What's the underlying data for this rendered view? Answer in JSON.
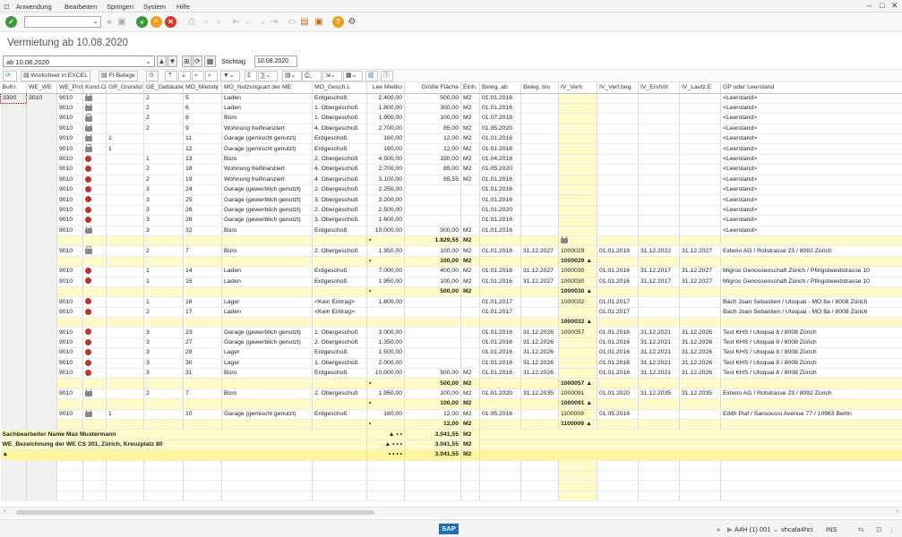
{
  "menu": {
    "items": [
      "Anwendung",
      "Bearbeiten",
      "Springen",
      "System",
      "Hilfe"
    ]
  },
  "toolbar": {
    "command_value": ""
  },
  "title": "Vermietung ab 10.08.2020",
  "selection": {
    "variant": "ab 10.08.2020",
    "stichtag_label": "Stichtag",
    "stichtag_value": "10.08.2020"
  },
  "grid_toolbar": {
    "worksheet_label": "Worksheet in EXCEL",
    "fi_label": "FI-Belege"
  },
  "table": {
    "headers": [
      "BuKr.",
      "WE_WE",
      "WE_Prctr",
      "Kond.Obj.I",
      "GR_Grundst",
      "GE_Gebäude",
      "MO_Mietobj",
      "MO_Nutzungsart der ME",
      "MO_Gesch.L",
      "Lee Mietko",
      "Größe Fläche",
      "Einh.",
      "Beleg. ab",
      "Beleg. bis",
      "IV_Vertr.",
      "IV_Vert.beg.",
      "IV_ErstVrt",
      "IV_Laufz.E",
      "GP oder Leerstand"
    ],
    "rows": [
      {
        "t": "d",
        "c": [
          "3300",
          "3010",
          "9010",
          "lock",
          "",
          "2",
          "5",
          "Laden",
          "Erdgeschoß",
          "2.400,00",
          "500,00",
          "M2",
          "01.01.2016",
          "",
          "",
          "",
          "",
          "",
          "<Leerstand>"
        ]
      },
      {
        "t": "d",
        "c": [
          "",
          "",
          "9010",
          "lock",
          "",
          "2",
          "6",
          "Laden",
          "1. Obergeschoß",
          "1.800,00",
          "300,00",
          "M2",
          "01.01.2016",
          "",
          "",
          "",
          "",
          "",
          "<Leerstand>"
        ]
      },
      {
        "t": "d",
        "c": [
          "",
          "",
          "9010",
          "lock",
          "",
          "2",
          "8",
          "Büro",
          "1. Obergeschoß",
          "1.950,00",
          "100,00",
          "M2",
          "01.07.2018",
          "",
          "",
          "",
          "",
          "",
          "<Leerstand>"
        ]
      },
      {
        "t": "d",
        "c": [
          "",
          "",
          "9010",
          "lock",
          "",
          "2",
          "9",
          "Wohnung freifinanziert",
          "4. Obergeschoß",
          "2.700,00",
          "85,00",
          "M2",
          "01.05.2020",
          "",
          "",
          "",
          "",
          "",
          "<Leerstand>"
        ]
      },
      {
        "t": "d",
        "c": [
          "",
          "",
          "9010",
          "lock",
          "1",
          "",
          "11",
          "Garage (gemischt genutzt)",
          "Erdgeschoß",
          "160,00",
          "12,00",
          "M2",
          "01.01.2016",
          "",
          "",
          "",
          "",
          "",
          "<Leerstand>"
        ]
      },
      {
        "t": "d",
        "c": [
          "",
          "",
          "9010",
          "lock",
          "1",
          "",
          "12",
          "Garage (gemischt genutzt)",
          "Erdgeschoß",
          "160,00",
          "12,00",
          "M2",
          "01.01.2016",
          "",
          "",
          "",
          "",
          "",
          "<Leerstand>"
        ]
      },
      {
        "t": "d",
        "c": [
          "",
          "",
          "9010",
          "stop",
          "",
          "1",
          "13",
          "Büro",
          "2. Obergeschoß",
          "4.500,00",
          "150,00",
          "M2",
          "01.04.2018",
          "",
          "",
          "",
          "",
          "",
          "<Leerstand>"
        ]
      },
      {
        "t": "d",
        "c": [
          "",
          "",
          "9010",
          "stop",
          "",
          "2",
          "18",
          "Wohnung freifinanziert",
          "4. Obergeschoß",
          "2.700,00",
          "85,00",
          "M2",
          "01.05.2020",
          "",
          "",
          "",
          "",
          "",
          "<Leerstand>"
        ]
      },
      {
        "t": "d",
        "c": [
          "",
          "",
          "9010",
          "stop",
          "",
          "2",
          "19",
          "Wohnung freifinanziert",
          "4. Obergeschoß",
          "3.100,00",
          "85,55",
          "M2",
          "01.01.2016",
          "",
          "",
          "",
          "",
          "",
          "<Leerstand>"
        ]
      },
      {
        "t": "d",
        "c": [
          "",
          "",
          "9010",
          "stop",
          "",
          "3",
          "24",
          "Garage (gewerblich genutzt)",
          "2. Obergeschoß",
          "2.250,00",
          "",
          "",
          "01.01.2016",
          "",
          "",
          "",
          "",
          "",
          "<Leerstand>"
        ]
      },
      {
        "t": "d",
        "c": [
          "",
          "",
          "9010",
          "stop",
          "",
          "3",
          "25",
          "Garage (gewerblich genutzt)",
          "3. Obergeschoß",
          "3.200,00",
          "",
          "",
          "01.01.2016",
          "",
          "",
          "",
          "",
          "",
          "<Leerstand>"
        ]
      },
      {
        "t": "d",
        "c": [
          "",
          "",
          "9010",
          "stop",
          "",
          "3",
          "26",
          "Garage (gewerblich genutzt)",
          "2. Obergeschoß",
          "2.500,00",
          "",
          "",
          "01.01.2020",
          "",
          "",
          "",
          "",
          "",
          "<Leerstand>"
        ]
      },
      {
        "t": "d",
        "c": [
          "",
          "",
          "9010",
          "stop",
          "",
          "3",
          "28",
          "Garage (gewerblich genutzt)",
          "3. Obergeschoß",
          "1.600,00",
          "",
          "",
          "01.01.2016",
          "",
          "",
          "",
          "",
          "",
          "<Leerstand>"
        ]
      },
      {
        "t": "d",
        "c": [
          "",
          "",
          "9010",
          "lock",
          "",
          "3",
          "32",
          "Büro",
          "Erdgeschoß",
          "10.000,00",
          "500,00",
          "M2",
          "01.01.2016",
          "",
          "",
          "",
          "",
          "",
          "<Leerstand>"
        ]
      },
      {
        "t": "s",
        "c": [
          "",
          "",
          "",
          "",
          "",
          "",
          "",
          "",
          "",
          "•",
          "1.829,55",
          "M2",
          "",
          "",
          "lock",
          "",
          "",
          "",
          ""
        ]
      },
      {
        "t": "d",
        "c": [
          "",
          "",
          "9010",
          "lock",
          "",
          "2",
          "7",
          "Büro",
          "2. Obergeschoß",
          "1.950,00",
          "100,00",
          "M2",
          "01.01.2018",
          "31.12.2027",
          "1000029",
          "01.01.2018",
          "31.12.2022",
          "31.12.2027",
          "Exterio AG / Rotstrasse 23 / 8092 Zürich"
        ]
      },
      {
        "t": "s",
        "c": [
          "",
          "",
          "",
          "",
          "",
          "",
          "",
          "",
          "",
          "•",
          "100,00",
          "M2",
          "",
          "",
          "1000029 ▲",
          "",
          "",
          "",
          ""
        ]
      },
      {
        "t": "d",
        "c": [
          "",
          "",
          "9010",
          "stop",
          "",
          "1",
          "14",
          "Laden",
          "Erdgeschoß",
          "7.000,00",
          "400,00",
          "M2",
          "01.01.2016",
          "31.12.2027",
          "1000030",
          "01.01.2016",
          "31.12.2017",
          "31.12.2027",
          "Migros Genossenschaft Zürich / Pfingstweidstrasse 10"
        ]
      },
      {
        "t": "d",
        "c": [
          "",
          "",
          "9010",
          "stop",
          "",
          "1",
          "15",
          "Laden",
          "Erdgeschoß",
          "1.950,00",
          "100,00",
          "M2",
          "01.01.2016",
          "31.12.2027",
          "1000030",
          "01.01.2016",
          "31.12.2017",
          "31.12.2027",
          "Migros Genossenschaft Zürich / Pfingstweidstrasse 10"
        ]
      },
      {
        "t": "s",
        "c": [
          "",
          "",
          "",
          "",
          "",
          "",
          "",
          "",
          "",
          "•",
          "500,00",
          "M2",
          "",
          "",
          "1000030 ▲",
          "",
          "",
          "",
          ""
        ]
      },
      {
        "t": "d",
        "c": [
          "",
          "",
          "9010",
          "stop",
          "",
          "1",
          "16",
          "Lager",
          "<Kein Eintrag>",
          "1.800,00",
          "",
          "",
          "01.01.2017",
          "",
          "1000032",
          "01.01.2017",
          "",
          "",
          "Bach Joan Sebastien / Utoquai - MO 8a / 8008 Zürich"
        ]
      },
      {
        "t": "d",
        "c": [
          "",
          "",
          "9010",
          "stop",
          "",
          "2",
          "17",
          "Laden",
          "<Kein Eintrag>",
          "",
          "",
          "",
          "01.01.2017",
          "",
          "",
          "01.01.2017",
          "",
          "",
          "Bach Joan Sebastien / Utoquai - MO 8a / 8008 Zürich"
        ]
      },
      {
        "t": "s",
        "c": [
          "",
          "",
          "",
          "",
          "",
          "",
          "",
          "",
          "",
          "",
          "",
          "",
          "",
          "",
          "1000032 ▲",
          "",
          "",
          "",
          ""
        ]
      },
      {
        "t": "d",
        "c": [
          "",
          "",
          "9010",
          "stop",
          "",
          "3",
          "23",
          "Garage (gewerblich genutzt)",
          "1. Obergeschoß",
          "3.000,00",
          "",
          "",
          "01.01.2016",
          "31.12.2026",
          "1000057",
          "01.01.2016",
          "31.12.2021",
          "31.12.2026",
          "Test KHS / Utoquai 8 / 8008 Zürich"
        ]
      },
      {
        "t": "d",
        "c": [
          "",
          "",
          "9010",
          "stop",
          "",
          "3",
          "27",
          "Garage (gewerblich genutzt)",
          "2. Obergeschoß",
          "1.350,00",
          "",
          "",
          "01.01.2016",
          "31.12.2026",
          "",
          "01.01.2016",
          "31.12.2021",
          "31.12.2026",
          "Test KHS / Utoquai 8 / 8008 Zürich"
        ]
      },
      {
        "t": "d",
        "c": [
          "",
          "",
          "9010",
          "stop",
          "",
          "3",
          "29",
          "Lager",
          "Erdgeschoß",
          "1.500,00",
          "",
          "",
          "01.01.2016",
          "31.12.2026",
          "",
          "01.01.2016",
          "31.12.2021",
          "31.12.2026",
          "Test KHS / Utoquai 8 / 8008 Zürich"
        ]
      },
      {
        "t": "d",
        "c": [
          "",
          "",
          "9010",
          "stop",
          "",
          "3",
          "30",
          "Lager",
          "1. Obergeschoß",
          "2.000,00",
          "",
          "",
          "01.01.2016",
          "31.12.2026",
          "",
          "01.01.2016",
          "31.12.2021",
          "31.12.2026",
          "Test KHS / Utoquai 8 / 8008 Zürich"
        ]
      },
      {
        "t": "d",
        "c": [
          "",
          "",
          "9010",
          "stop",
          "",
          "3",
          "31",
          "Büro",
          "Erdgeschoß",
          "10.000,00",
          "500,00",
          "M2",
          "01.01.2016",
          "31.12.2026",
          "",
          "01.01.2016",
          "31.12.2021",
          "31.12.2026",
          "Test KHS / Utoquai 8 / 8008 Zürich"
        ]
      },
      {
        "t": "s",
        "c": [
          "",
          "",
          "",
          "",
          "",
          "",
          "",
          "",
          "",
          "•",
          "500,00",
          "M2",
          "",
          "",
          "1000057 ▲",
          "",
          "",
          "",
          ""
        ]
      },
      {
        "t": "d",
        "c": [
          "",
          "",
          "9010",
          "lock",
          "",
          "2",
          "7",
          "Büro",
          "2. Obergeschoß",
          "1.950,00",
          "100,00",
          "M2",
          "01.01.2020",
          "31.12.2035",
          "1000091",
          "01.01.2020",
          "31.12.2035",
          "31.12.2035",
          "Exterio AG / Rotstrasse 23 / 8092 Zürich"
        ]
      },
      {
        "t": "s",
        "c": [
          "",
          "",
          "",
          "",
          "",
          "",
          "",
          "",
          "",
          "•",
          "100,00",
          "M2",
          "",
          "",
          "1000091 ▲",
          "",
          "",
          "",
          ""
        ]
      },
      {
        "t": "d",
        "c": [
          "",
          "",
          "9010",
          "lock",
          "1",
          "",
          "10",
          "Garage (gemischt genutzt)",
          "Erdgeschoß",
          "160,00",
          "12,00",
          "M2",
          "01.05.2016",
          "",
          "1100009",
          "01.05.2016",
          "",
          "",
          "Edith Piaf / Sansoussi Avenue 77 / 10963 Berlin"
        ]
      },
      {
        "t": "s",
        "c": [
          "",
          "",
          "",
          "",
          "",
          "",
          "",
          "",
          "",
          "•",
          "12,00",
          "M2",
          "",
          "",
          "1100009 ▲",
          "",
          "",
          "",
          ""
        ]
      }
    ],
    "totals": [
      {
        "label": "Sachbearbeiter Name Max Mustermann",
        "marks": "▲ • •",
        "value": "3.041,55",
        "unit": "M2"
      },
      {
        "label": "WE_Bezeichnung der WE CS 301, Zürich, Kreuzplatz 80",
        "marks": "▲ • • •",
        "value": "3.041,55",
        "unit": "M2"
      },
      {
        "label": "▲",
        "marks": "• • • •",
        "value": "3.041,55",
        "unit": "M2"
      }
    ]
  },
  "status": {
    "system": "A4H (1) 001",
    "server": "vhcala4hci",
    "mode": "INS"
  },
  "colors": {
    "highlight": "#fffbc8",
    "total": "#fff59a",
    "accent": "#1d6fb8"
  }
}
